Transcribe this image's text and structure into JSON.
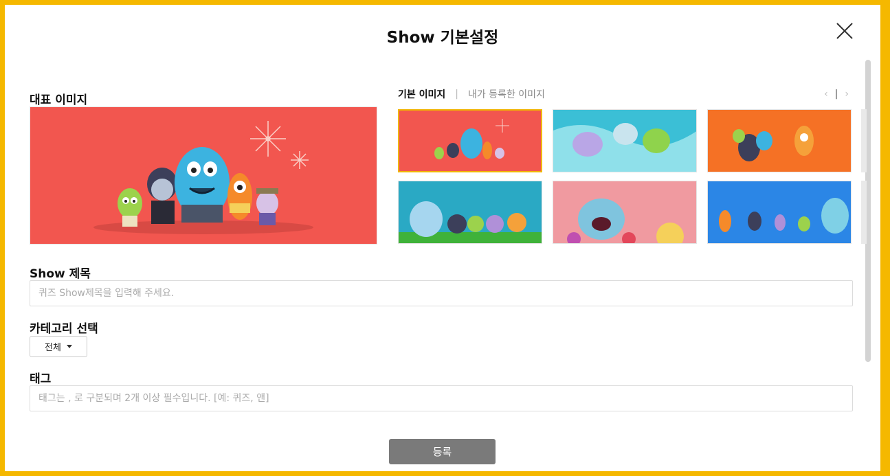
{
  "modal": {
    "title": "Show 기본설정"
  },
  "representative_image": {
    "label": "대표 이미지"
  },
  "image_tabs": {
    "tabs": [
      {
        "label": "기본 이미지",
        "active": true
      },
      {
        "label": "내가 등록한 이미지",
        "active": false
      }
    ],
    "separator": "|"
  },
  "pager": {
    "prev": "‹",
    "separator": "|",
    "next": "›"
  },
  "thumbnails": [
    {
      "bg": "#f2564f",
      "selected": true
    },
    {
      "bg": "#3bbfd6",
      "selected": false
    },
    {
      "bg": "#f57125",
      "selected": false
    },
    {
      "bg": "#2aa9c4",
      "selected": false
    },
    {
      "bg": "#f09aa0",
      "selected": false
    },
    {
      "bg": "#2b86e6",
      "selected": false
    }
  ],
  "show_title": {
    "label": "Show 제목",
    "placeholder": "퀴즈 Show제목을 입력해 주세요.",
    "value": ""
  },
  "category": {
    "label": "카테고리 선택",
    "selected": "전체"
  },
  "tags": {
    "label": "태그",
    "placeholder": "태그는 , 로 구분되며 2개 이상 필수입니다. [예: 퀴즈, 앤]",
    "value": ""
  },
  "submit": {
    "label": "등록"
  },
  "colors": {
    "frame": "#f5b800",
    "selected_border": "#f0b400",
    "submit_bg": "#7a7a7a"
  }
}
